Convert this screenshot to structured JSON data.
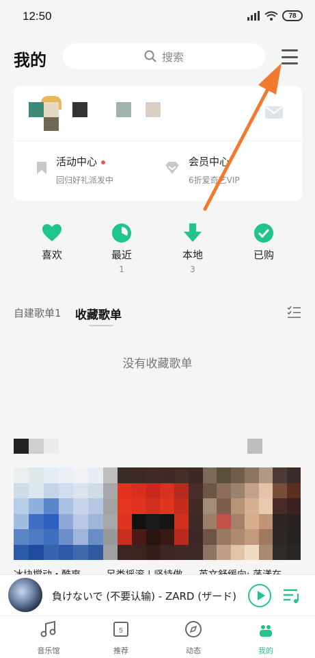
{
  "status": {
    "time": "12:50",
    "battery": "78"
  },
  "header": {
    "title": "我的",
    "search_placeholder": "搜索"
  },
  "card": {
    "activity": {
      "title": "活动中心",
      "sub": "回归好礼派发中"
    },
    "vip": {
      "title": "会员中心",
      "sub": "6折爱奇艺VIP"
    }
  },
  "quick": [
    {
      "label": "喜欢",
      "count": "",
      "icon": "heart-icon"
    },
    {
      "label": "最近",
      "count": "1",
      "icon": "clock-icon"
    },
    {
      "label": "本地",
      "count": "3",
      "icon": "download-icon"
    },
    {
      "label": "已购",
      "count": "",
      "icon": "check-icon"
    }
  ],
  "tabs": {
    "created": "自建歌单1",
    "collected": "收藏歌单"
  },
  "empty": "没有收藏歌单",
  "recommend": {
    "captions": [
      "冰块搅动・酷爽",
      "另类摇滚 | 坚持做",
      "英文舒缓向: 荡漾在"
    ]
  },
  "player": {
    "song": "負けないで (不要认输) - ZARD (ザード)"
  },
  "tabbar": [
    {
      "label": "音乐馆",
      "icon": "music-note-icon"
    },
    {
      "label": "推荐",
      "icon": "calendar-icon"
    },
    {
      "label": "动态",
      "icon": "compass-icon"
    },
    {
      "label": "我的",
      "icon": "profile-icon"
    }
  ],
  "colors": {
    "accent": "#21c48a",
    "annotation": "#f27a2e"
  }
}
